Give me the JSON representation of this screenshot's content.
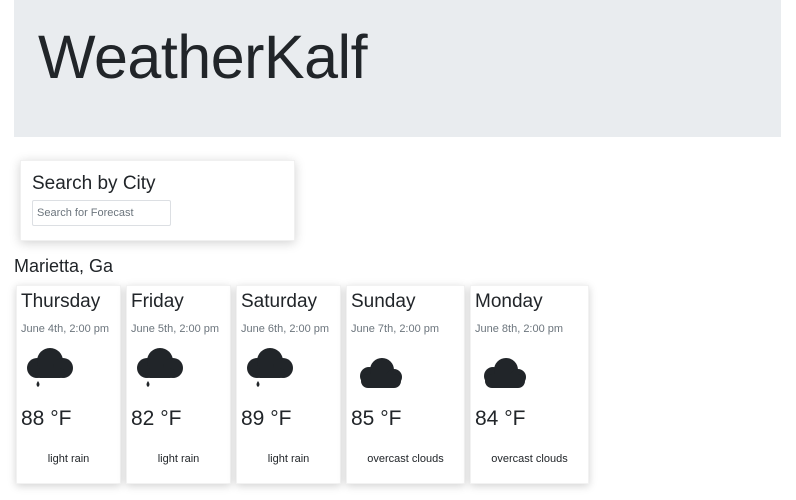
{
  "app": {
    "title": "WeatherKalf"
  },
  "search": {
    "title": "Search by City",
    "placeholder": "Search for Forecast",
    "value": ""
  },
  "location": {
    "city": "Marietta, Ga"
  },
  "forecast": [
    {
      "day": "Thursday",
      "date": "June 4th, 2:00 pm",
      "temp": "88 °F",
      "description": "light rain",
      "icon": "rain-cloud-icon"
    },
    {
      "day": "Friday",
      "date": "June 5th, 2:00 pm",
      "temp": "82 °F",
      "description": "light rain",
      "icon": "rain-cloud-icon"
    },
    {
      "day": "Saturday",
      "date": "June 6th, 2:00 pm",
      "temp": "89 °F",
      "description": "light rain",
      "icon": "rain-cloud-icon"
    },
    {
      "day": "Sunday",
      "date": "June 7th, 2:00 pm",
      "temp": "85 °F",
      "description": "overcast clouds",
      "icon": "cloud-icon"
    },
    {
      "day": "Monday",
      "date": "June 8th, 2:00 pm",
      "temp": "84 °F",
      "description": "overcast clouds",
      "icon": "cloud-icon"
    }
  ],
  "colors": {
    "header_bg": "#e9ecef",
    "text": "#212529",
    "muted": "#6c757d",
    "icon": "#212529"
  }
}
